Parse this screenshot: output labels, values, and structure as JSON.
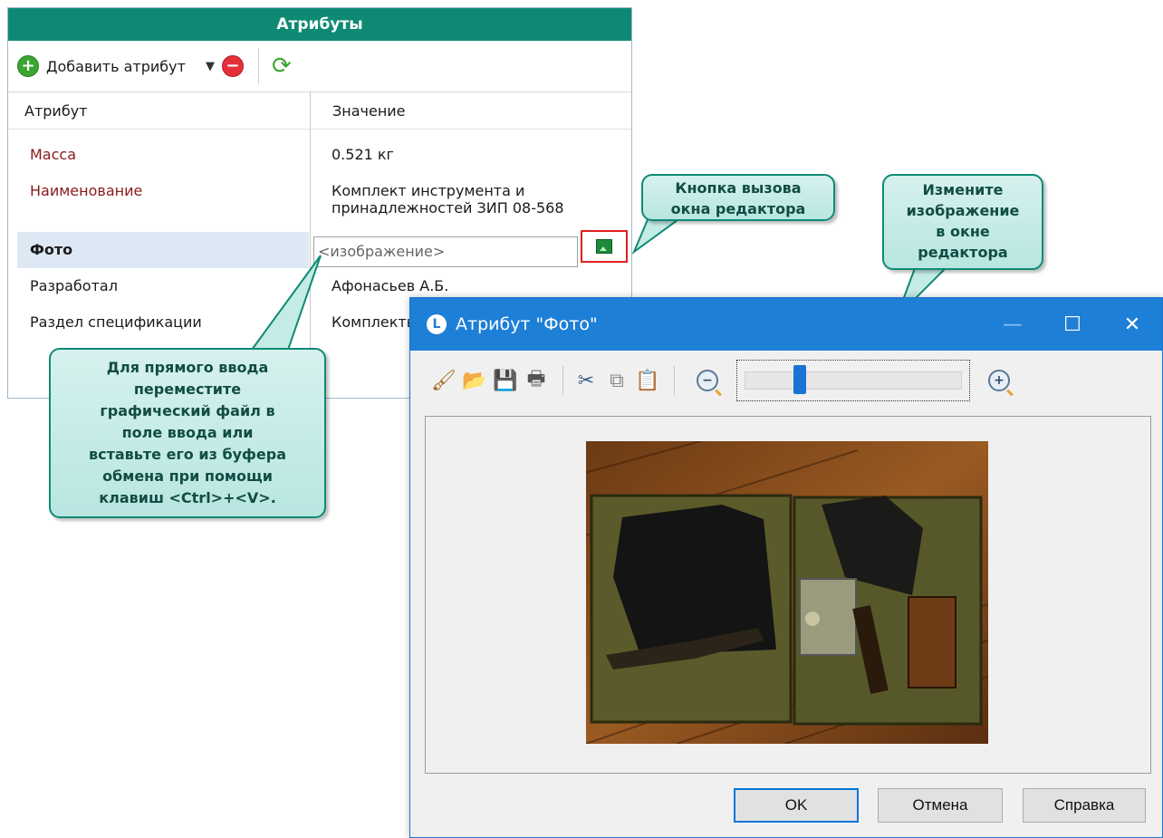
{
  "panel": {
    "title": "Атрибуты",
    "toolbar": {
      "add_label": "Добавить атрибут"
    },
    "columns": {
      "attribute": "Атрибут",
      "value": "Значение"
    },
    "rows": [
      {
        "name": "Масса",
        "value": "0.521 кг"
      },
      {
        "name": "Наименование",
        "value_line1": "Комплект инструмента и",
        "value_line2": "принадлежностей ЗИП 08-568"
      },
      {
        "name": "Фото",
        "placeholder": "<изображение>"
      },
      {
        "name": "Разработал",
        "value": "Афонасьев А.Б."
      },
      {
        "name": "Раздел спецификации",
        "value": "Комплекты"
      }
    ]
  },
  "callouts": {
    "editor_button": [
      "Кнопка вызова",
      "окна редактора"
    ],
    "change_image": [
      "Измените",
      "изображение",
      "в окне",
      "редактора"
    ],
    "direct_input": [
      "Для прямого ввода",
      "переместите",
      "графический файл в",
      "поле ввода или",
      "вставьте его из буфера",
      "обмена при помощи",
      "клавиш <Ctrl>+<V>."
    ]
  },
  "dialog": {
    "title": "Атрибут \"Фото\"",
    "zoom_level": 0.25,
    "buttons": {
      "ok": "OK",
      "cancel": "Отмена",
      "help": "Справка"
    }
  },
  "colors": {
    "header_green": "#0e8a74",
    "title_blue": "#1e7fd6",
    "highlight_red": "#e02020"
  }
}
